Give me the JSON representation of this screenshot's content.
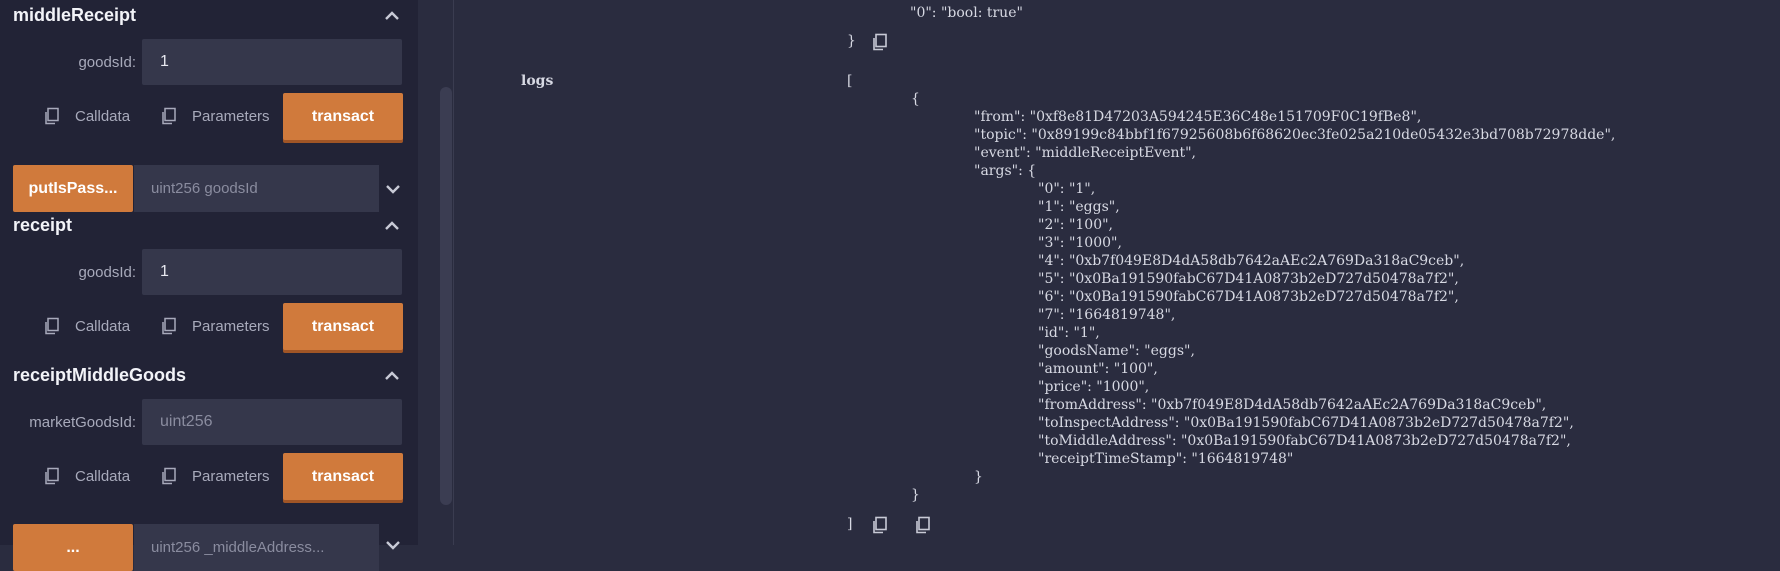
{
  "sections": {
    "middle_receipt": {
      "title": "middleReceipt",
      "field_label": "goodsId:",
      "field_value": "1",
      "calldata": "Calldata",
      "parameters": "Parameters",
      "transact": "transact"
    },
    "put_is_pass": {
      "button": "putIsPass...",
      "placeholder": "uint256 goodsId"
    },
    "receipt": {
      "title": "receipt",
      "field_label": "goodsId:",
      "field_value": "1",
      "calldata": "Calldata",
      "parameters": "Parameters",
      "transact": "transact"
    },
    "receipt_middle_goods": {
      "title": "receiptMiddleGoods",
      "field_label": "marketGoodsId:",
      "field_placeholder": "uint256",
      "calldata": "Calldata",
      "parameters": "Parameters",
      "transact": "transact"
    },
    "bottom_partial": {
      "button": "...",
      "placeholder": "uint256 _middleAddress..."
    }
  },
  "colors": {
    "accent": "#d07a3c",
    "panel": "#222336",
    "main": "#2a2c3f",
    "input": "#35374b"
  },
  "output": {
    "decoded_output_line": "\"0\": \"bool: true\"",
    "close_brace": "}",
    "logs_label": "logs",
    "open_bracket": "[",
    "close_bracket": "]",
    "obj_open": "{",
    "obj_close": "}",
    "from": "\"from\": \"0xf8e81D47203A594245E36C48e151709F0C19fBe8\",",
    "topic": "\"topic\": \"0x89199c84bbf1f67925608b6f68620ec3fe025a210de05432e3bd708b72978dde\",",
    "event": "\"event\": \"middleReceiptEvent\",",
    "args_open": "\"args\": {",
    "args": [
      "\"0\": \"1\",",
      "\"1\": \"eggs\",",
      "\"2\": \"100\",",
      "\"3\": \"1000\",",
      "\"4\": \"0xb7f049E8D4dA58db7642aAEc2A769Da318aC9ceb\",",
      "\"5\": \"0x0Ba191590fabC67D41A0873b2eD727d50478a7f2\",",
      "\"6\": \"0x0Ba191590fabC67D41A0873b2eD727d50478a7f2\",",
      "\"7\": \"1664819748\",",
      "\"id\": \"1\",",
      "\"goodsName\": \"eggs\",",
      "\"amount\": \"100\",",
      "\"price\": \"1000\",",
      "\"fromAddress\": \"0xb7f049E8D4dA58db7642aAEc2A769Da318aC9ceb\",",
      "\"toInspectAddress\": \"0x0Ba191590fabC67D41A0873b2eD727d50478a7f2\",",
      "\"toMiddleAddress\": \"0x0Ba191590fabC67D41A0873b2eD727d50478a7f2\",",
      "\"receiptTimeStamp\": \"1664819748\""
    ],
    "args_close": "}"
  }
}
